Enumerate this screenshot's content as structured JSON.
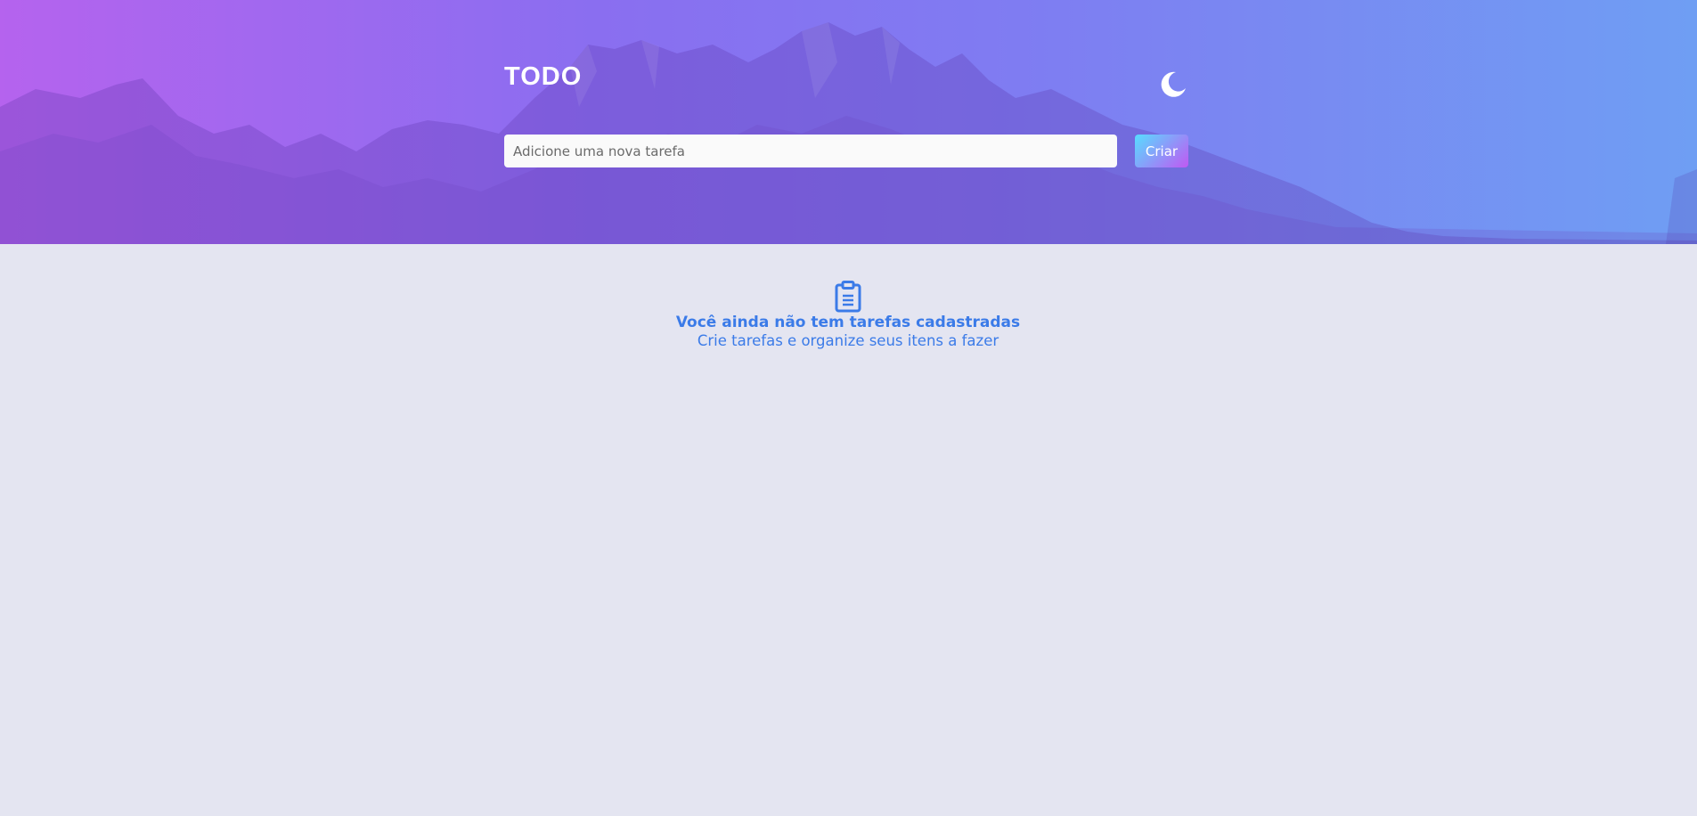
{
  "header": {
    "title": "TODO",
    "theme_toggle_icon": "moon-icon"
  },
  "new_task": {
    "placeholder": "Adicione uma nova tarefa",
    "value": "",
    "create_label": "Criar"
  },
  "empty_state": {
    "icon": "clipboard-icon",
    "title": "Você ainda não tem tarefas cadastradas",
    "subtitle": "Crie tarefas e organize seus itens a fazer"
  },
  "colors": {
    "accent": "#3b7be8",
    "background": "#e4e5f1",
    "hero_gradient_start": "#b563ee",
    "hero_gradient_end": "#6f9ef3",
    "button_gradient_start": "#57ddff",
    "button_gradient_end": "#c058f3"
  }
}
